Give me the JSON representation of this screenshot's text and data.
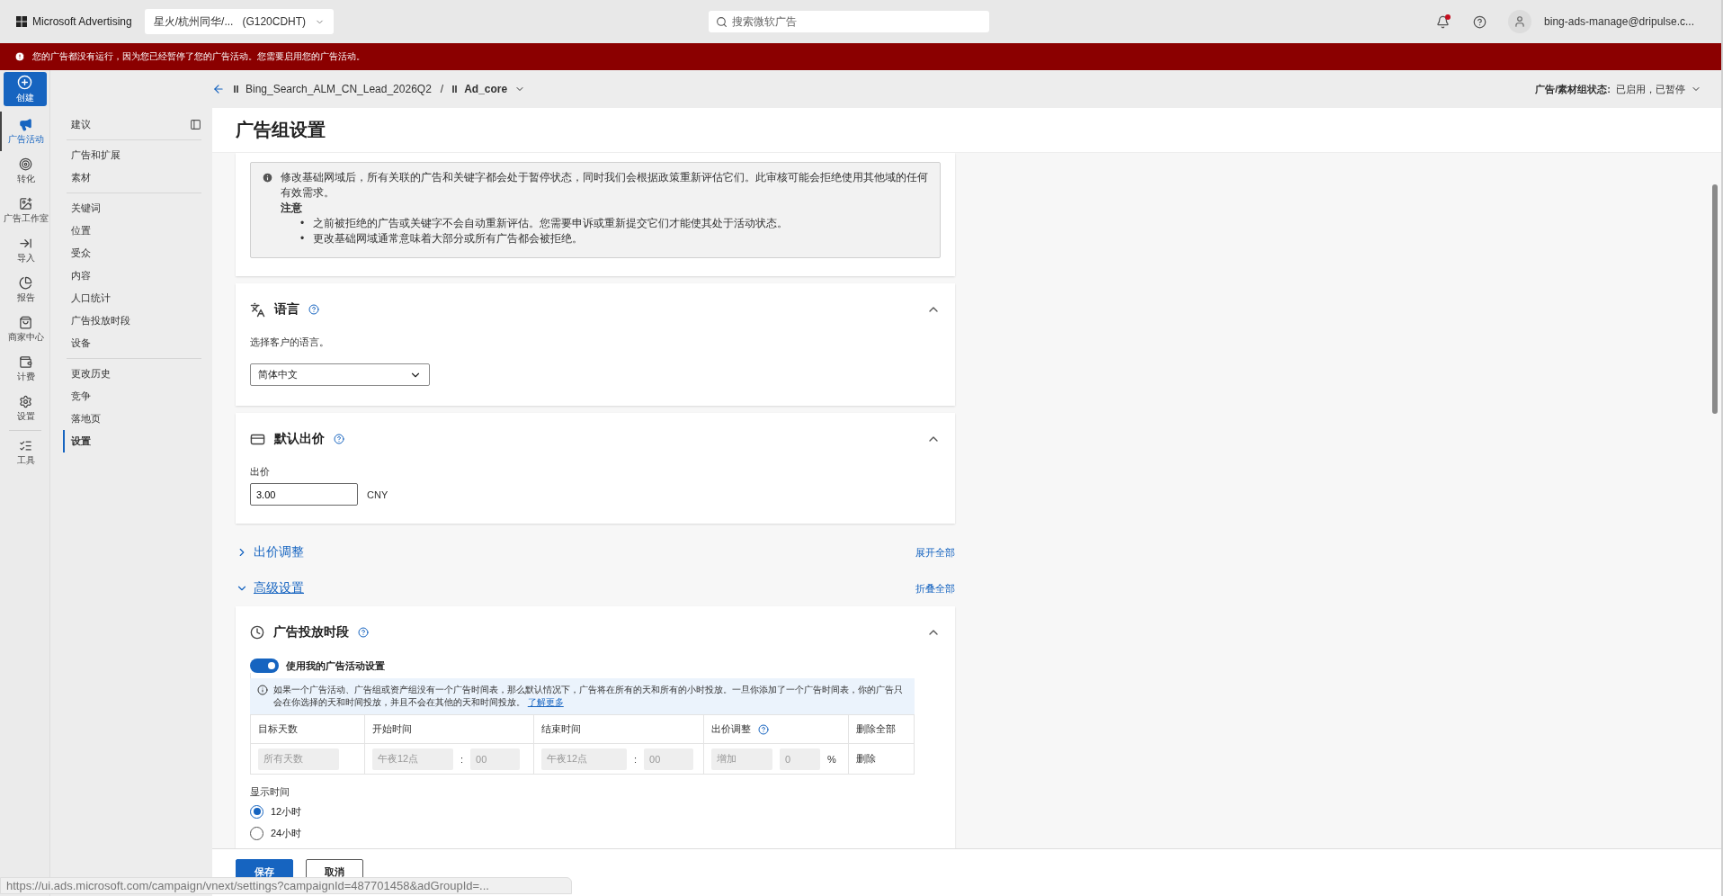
{
  "top_bar": {
    "brand": "Microsoft Advertising",
    "account": "星火/杭州同华/...",
    "account_id": "(G120CDHT)",
    "search_placeholder": "搜索微软广告",
    "has_notification": true,
    "user": "bing-ads-manage@dripulse.c..."
  },
  "alert": {
    "text": "您的广告都没有运行，因为您已经暂停了您的广告活动。您需要启用您的广告活动。"
  },
  "create_button": {
    "label": "创建"
  },
  "rail": [
    {
      "label": "广告活动",
      "selected": true
    },
    {
      "label": "转化",
      "selected": false
    },
    {
      "label": "广告工作室",
      "selected": false
    },
    {
      "label": "导入",
      "selected": false
    },
    {
      "label": "报告",
      "selected": false
    },
    {
      "label": "商家中心",
      "selected": false
    },
    {
      "label": "计费",
      "selected": false
    },
    {
      "label": "设置",
      "selected": false
    },
    {
      "label": "工具",
      "selected": false
    }
  ],
  "breadcrumb": {
    "campaign": "Bing_Search_ALM_CN_Lead_2026Q2",
    "separator": "/",
    "ad_group": "Ad_core",
    "status_label": "广告/素材组状态:",
    "status_value": "已启用，已暂停"
  },
  "sidebar": {
    "groups": [
      [
        {
          "label": "建议",
          "selected": false
        }
      ],
      [
        {
          "label": "广告和扩展",
          "selected": false
        },
        {
          "label": "素材",
          "selected": false
        }
      ],
      [
        {
          "label": "关键词",
          "selected": false
        },
        {
          "label": "位置",
          "selected": false
        },
        {
          "label": "受众",
          "selected": false
        },
        {
          "label": "内容",
          "selected": false
        },
        {
          "label": "人口统计",
          "selected": false
        },
        {
          "label": "广告投放时段",
          "selected": false
        },
        {
          "label": "设备",
          "selected": false
        }
      ],
      [
        {
          "label": "更改历史",
          "selected": false
        },
        {
          "label": "竞争",
          "selected": false
        },
        {
          "label": "落地页",
          "selected": false
        },
        {
          "label": "设置",
          "selected": true
        }
      ]
    ]
  },
  "page_title": "广告组设置",
  "domain_notice": {
    "text": "修改基础网域后，所有关联的广告和关键字都会处于暂停状态，同时我们会根据政策重新评估它们。此审核可能会拒绝使用其他域的任何有效需求。",
    "note_title": "注意",
    "bullet": "•",
    "notes": [
      "之前被拒绝的广告或关键字不会自动重新评估。您需要申诉或重新提交它们才能使其处于活动状态。",
      "更改基础网域通常意味着大部分或所有广告都会被拒绝。"
    ]
  },
  "language": {
    "title": "语言",
    "expanded": true,
    "description": "选择客户的语言。",
    "value": "简体中文"
  },
  "default_bid": {
    "title": "默认出价",
    "expanded": true,
    "field_label": "出价",
    "value": "3.00",
    "currency": "CNY"
  },
  "sections": [
    {
      "title": "出价调整",
      "expanded": false,
      "action": "展开全部"
    },
    {
      "title": "高级设置",
      "expanded": true,
      "action": "折叠全部"
    }
  ],
  "ad_schedule": {
    "title": "广告投放时段",
    "expanded": true,
    "toggle_label": "使用我的广告活动设置",
    "toggle_on": true,
    "info": "如果一个广告活动、广告组或资产组没有一个广告时间表，那么默认情况下，广告将在所有的天和所有的小时投放。一旦你添加了一个广告时间表，你的广告只会在你选择的天和时间投放，并且不会在其他的天和时间投放。",
    "learn_more": "了解更多",
    "columns": [
      "目标天数",
      "开始时间",
      "结束时间",
      "出价调整",
      "删除全部"
    ],
    "rows": [
      {
        "days": "所有天数",
        "start_hour": "午夜12点",
        "start_sep": ":",
        "start_minute": "00",
        "end_hour": "午夜12点",
        "end_sep": ":",
        "end_minute": "00",
        "bid_mode": "增加",
        "bid_value": "0",
        "unit": "%",
        "action": "删除"
      }
    ],
    "time_format_label": "显示时间",
    "time_formats": [
      {
        "label": "12小时",
        "selected": true
      },
      {
        "label": "24小时",
        "selected": false
      }
    ]
  },
  "footer": {
    "buttons": [
      {
        "label": "保存",
        "kind": "primary"
      },
      {
        "label": "取消",
        "kind": "secondary"
      }
    ]
  },
  "status_url": "https://ui.ads.microsoft.com/campaign/vnext/settings?campaignId=487701458&adGroupId=..."
}
